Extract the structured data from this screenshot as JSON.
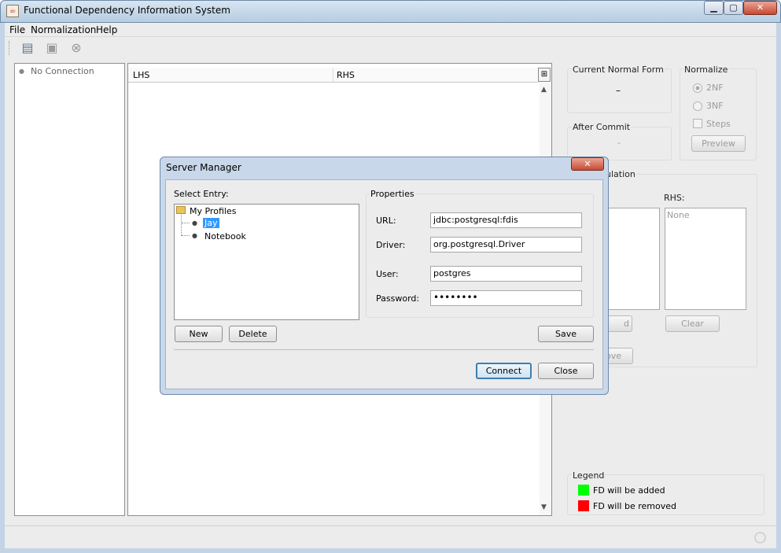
{
  "window": {
    "title": "Functional Dependency Information System",
    "min": "▁",
    "max": "▢",
    "close": "✕"
  },
  "menu": [
    "File",
    "Normalization",
    "Help"
  ],
  "toolbar": {
    "icons": [
      "server-icon",
      "save-icon",
      "stop-icon"
    ]
  },
  "tree": {
    "no_connection": "No Connection"
  },
  "table": {
    "lhs": "LHS",
    "rhs": "RHS"
  },
  "current_normal_form": {
    "label": "Current Normal Form",
    "value": "–"
  },
  "after_commit": {
    "label": "After Commit",
    "value": "-"
  },
  "normalize": {
    "label": "Normalize",
    "opt_2nf": "2NF",
    "opt_3nf": "3NF",
    "steps": "Steps",
    "preview": "Preview"
  },
  "manipulation": {
    "label": "ulation",
    "rhs_label": "RHS:",
    "rhs_value": "None",
    "left_btn": "d",
    "clear": "Clear",
    "remove_btn": "ove"
  },
  "legend": {
    "label": "Legend",
    "added": "FD will be added",
    "removed": "FD will be removed",
    "added_color": "#00ff00",
    "removed_color": "#ff0000"
  },
  "dialog": {
    "title": "Server Manager",
    "close": "✕",
    "select_entry": "Select Entry:",
    "tree_root": "My Profiles",
    "profiles": [
      "Jay",
      "Notebook"
    ],
    "properties": "Properties",
    "url_label": "URL:",
    "url": "jdbc:postgresql:fdis",
    "driver_label": "Driver:",
    "driver": "org.postgresql.Driver",
    "user_label": "User:",
    "user": "postgres",
    "password_label": "Password:",
    "password": "••••••••",
    "new": "New",
    "delete": "Delete",
    "save": "Save",
    "connect": "Connect",
    "close_btn": "Close"
  }
}
